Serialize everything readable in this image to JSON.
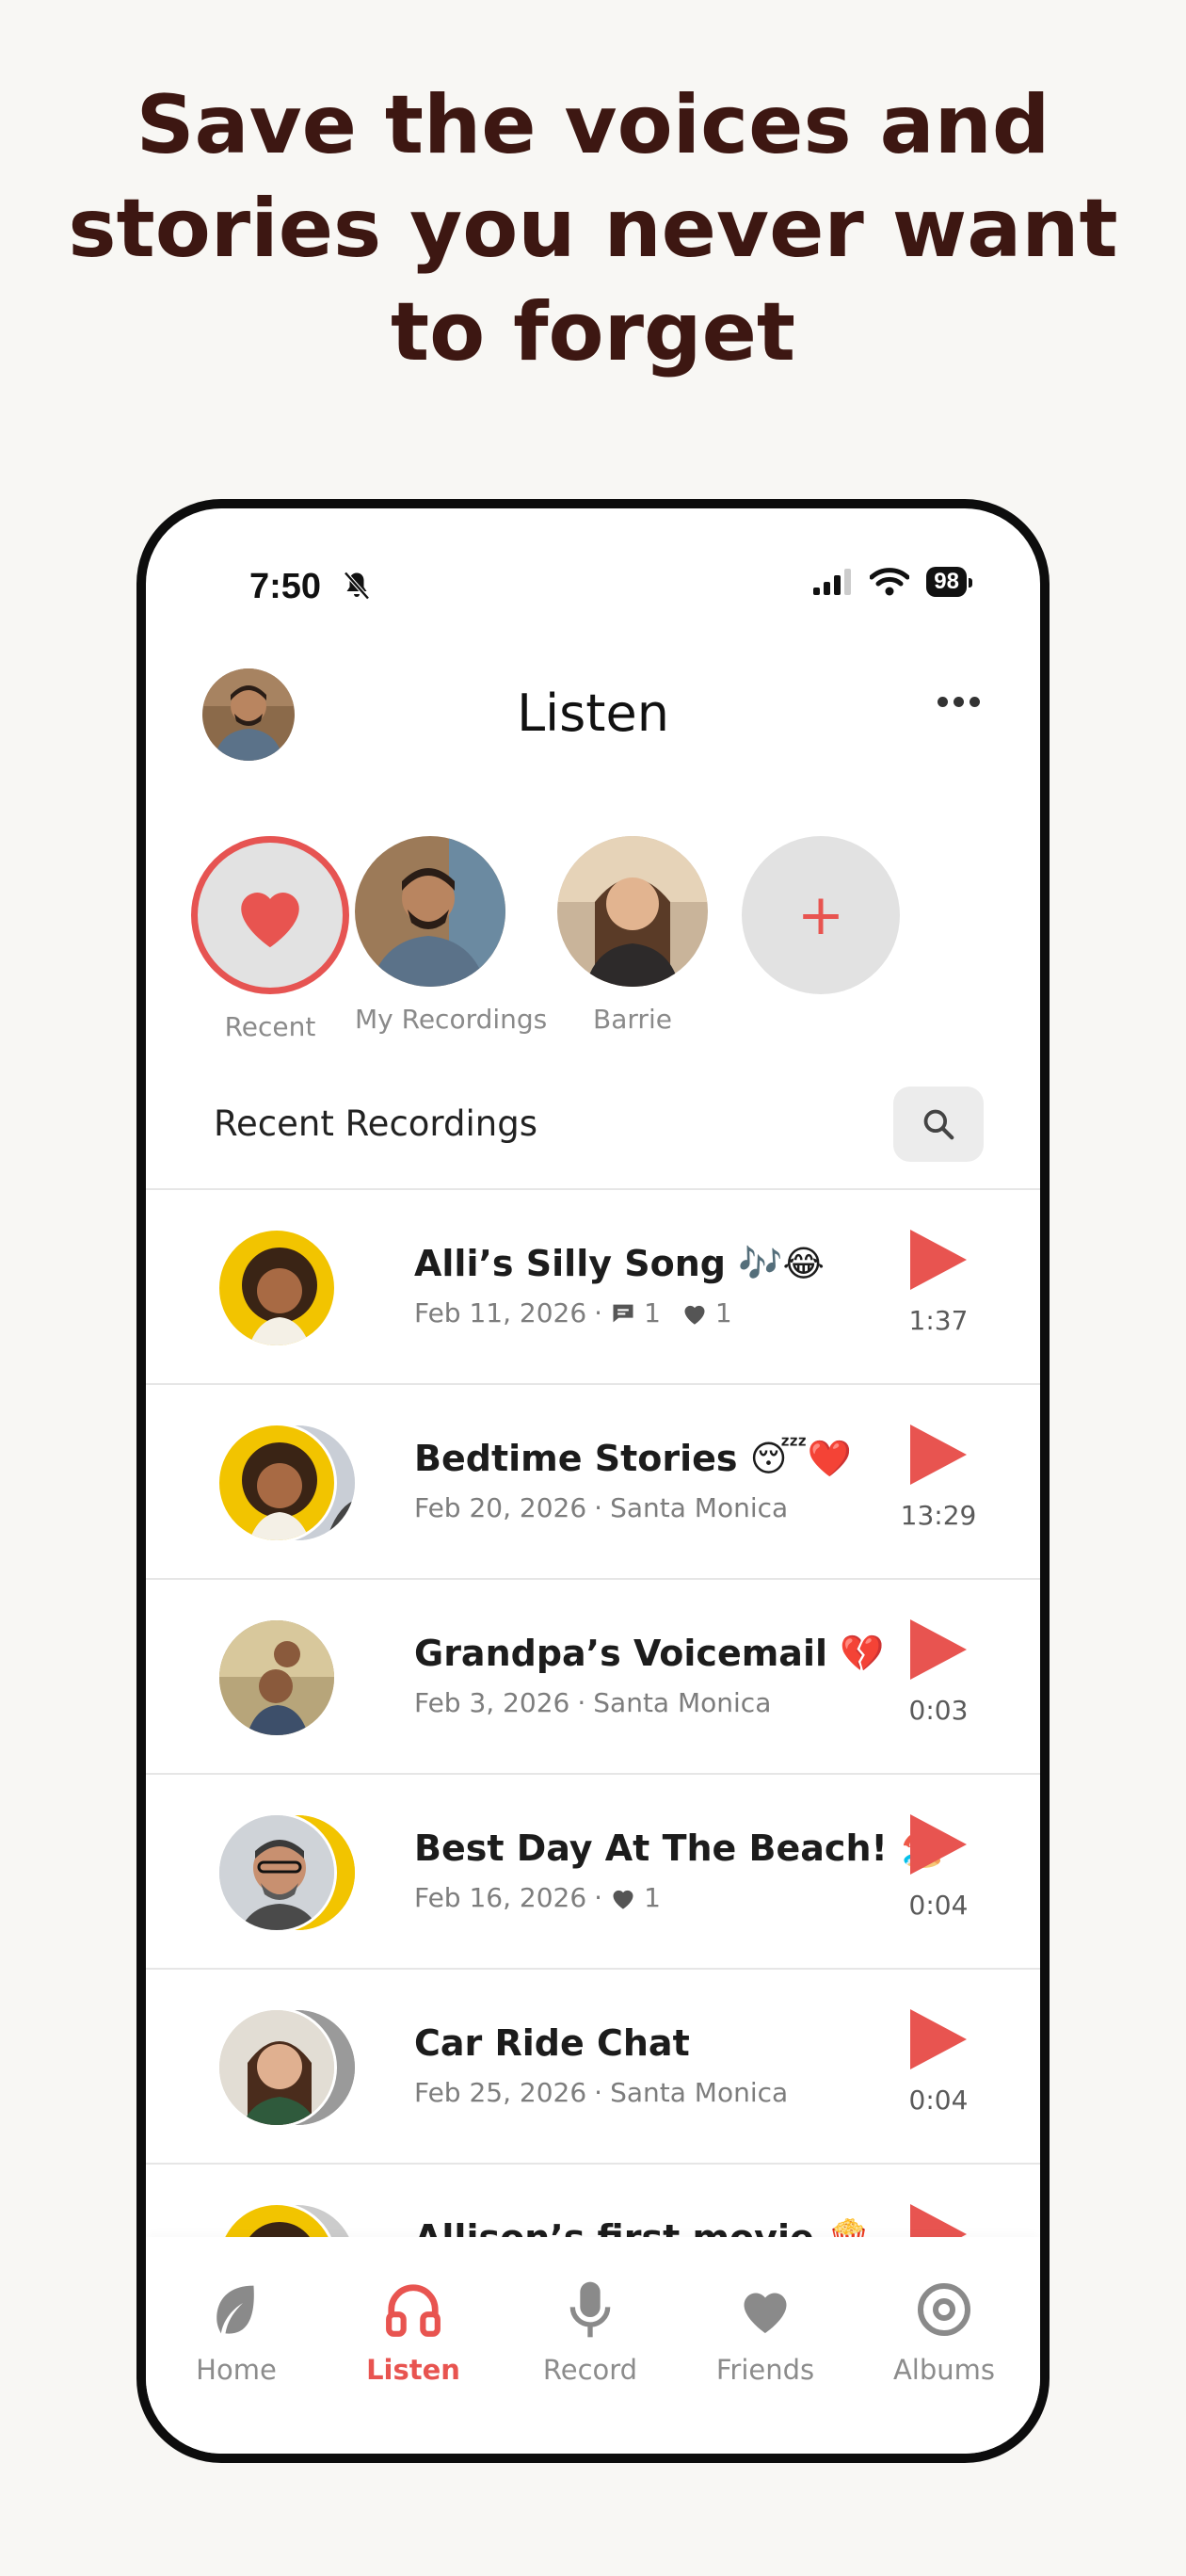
{
  "promo": {
    "headline_line1": "Save the voices and",
    "headline_line2": "stories you never want",
    "headline_line3": "to forget"
  },
  "status": {
    "time": "7:50",
    "battery": "98"
  },
  "nav": {
    "title": "Listen"
  },
  "stories": [
    {
      "label": "Recent"
    },
    {
      "label": "My Recordings"
    },
    {
      "label": "Barrie"
    },
    {
      "label": "+"
    }
  ],
  "section": {
    "title": "Recent Recordings"
  },
  "recordings": [
    {
      "title": "Alli’s Silly Song 🎶😂",
      "date": "Feb 11, 2026",
      "comments": "1",
      "likes": "1",
      "location": "",
      "duration": "1:37"
    },
    {
      "title": "Bedtime Stories 😴❤️",
      "date": "Feb 20, 2026",
      "location": "Santa Monica",
      "duration": "13:29"
    },
    {
      "title": "Grandpa’s Voicemail 💔",
      "date": "Feb 3, 2026",
      "location": "Santa Monica",
      "duration": "0:03"
    },
    {
      "title": "Best Day At The Beach! 🏖️",
      "date": "Feb 16, 2026",
      "likes": "1",
      "duration": "0:04"
    },
    {
      "title": "Car Ride Chat",
      "date": "Feb 25, 2026",
      "location": "Santa Monica",
      "duration": "0:04"
    },
    {
      "title": "Allison’s first movie 🍿",
      "date": "",
      "duration": ""
    }
  ],
  "tabs": [
    {
      "label": "Home",
      "icon": "leaf-icon"
    },
    {
      "label": "Listen",
      "icon": "headphones-icon"
    },
    {
      "label": "Record",
      "icon": "microphone-icon"
    },
    {
      "label": "Friends",
      "icon": "heart-icon"
    },
    {
      "label": "Albums",
      "icon": "disc-icon"
    }
  ],
  "colors": {
    "accent": "#e85450",
    "headline": "#3d1712",
    "background": "#f8f7f4"
  }
}
